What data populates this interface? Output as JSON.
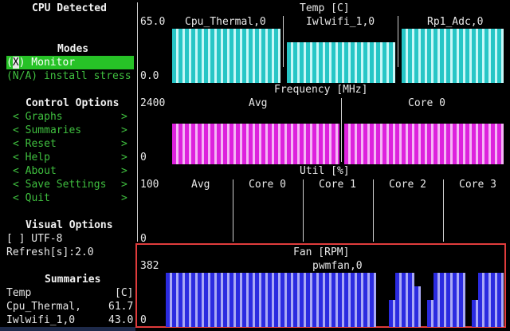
{
  "sidebar": {
    "cpu_detected": "CPU Detected",
    "modes_title": "Modes",
    "mode_monitor_prefix": "(",
    "mode_monitor_cursor": "X",
    "mode_monitor_suffix": ") Monitor",
    "mode_stress": "(N/A) install stress",
    "control_title": "Control Options",
    "controls": [
      {
        "label": "Graphs",
        "left": "<",
        "right": ">"
      },
      {
        "label": "Summaries",
        "left": "<",
        "right": ">"
      },
      {
        "label": "Reset",
        "left": "<",
        "right": ">"
      },
      {
        "label": "Help",
        "left": "<",
        "right": ">"
      },
      {
        "label": "About",
        "left": "<",
        "right": ">"
      },
      {
        "label": "Save Settings",
        "left": "<",
        "right": ">"
      },
      {
        "label": "Quit",
        "left": "<",
        "right": ">"
      }
    ],
    "visual_title": "Visual Options",
    "utf8": "[ ] UTF-8",
    "refresh": "Refresh[s]:2.0",
    "summaries_title": "Summaries",
    "summary_header": {
      "name": "Temp",
      "unit": "[C]"
    },
    "summary_rows": [
      {
        "name": "Cpu_Thermal,",
        "value": "61.7"
      },
      {
        "name": "Iwlwifi_1,0",
        "value": "43.0"
      }
    ]
  },
  "graphs": {
    "temp": {
      "title": "Temp [C]",
      "ymax": "65.0",
      "ymin": "0.0",
      "labels": [
        "Cpu_Thermal,0",
        "Iwlwifi_1,0",
        "Rp1_Adc,0"
      ]
    },
    "freq": {
      "title": "Frequency [MHz]",
      "ymax": "2400",
      "ymin": "0",
      "labels": [
        "Avg",
        "Core 0"
      ]
    },
    "util": {
      "title": "Util [%]",
      "ymax": "100",
      "ymin": "0",
      "labels": [
        "Avg",
        "Core 0",
        "Core 1",
        "Core 2",
        "Core 3"
      ]
    },
    "fan": {
      "title": "Fan [RPM]",
      "ymax": "382",
      "ymin": "0",
      "labels": [
        "pwmfan,0"
      ]
    }
  },
  "colors": {
    "temp": "#27c6c6",
    "freq": "#dd22dd",
    "fan": "#2b2be0",
    "selected": "#27c227",
    "highlight_border": "#e03c3c"
  }
}
